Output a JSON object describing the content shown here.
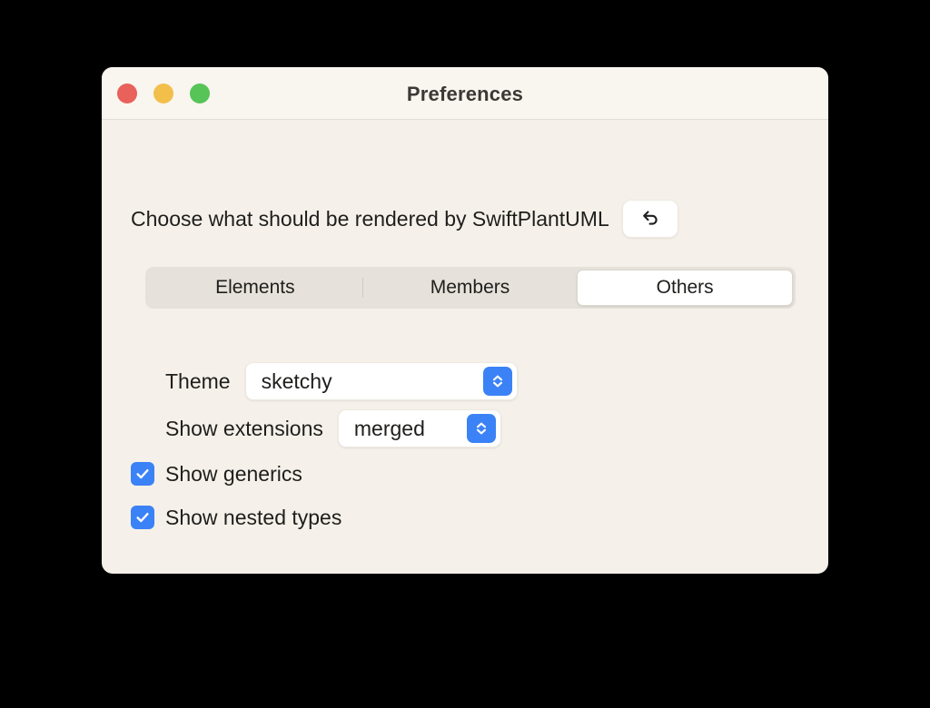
{
  "window": {
    "title": "Preferences",
    "traffic_lights": [
      {
        "name": "close",
        "color": "#E8615A"
      },
      {
        "name": "minimize",
        "color": "#F2BF4B"
      },
      {
        "name": "zoom",
        "color": "#57C457"
      }
    ],
    "background_color": "#F5F1EA",
    "titlebar_color": "#F9F5EF"
  },
  "description": {
    "text": "Choose what should be rendered by SwiftPlantUML",
    "reset_icon": "undo-arrow-icon"
  },
  "tabs": [
    {
      "label": "Elements",
      "selected": false
    },
    {
      "label": "Members",
      "selected": false
    },
    {
      "label": "Others",
      "selected": true
    }
  ],
  "fields": [
    {
      "label": "Theme",
      "value": "sketchy",
      "control": "popup-button",
      "stepper_icon": "chevron-up-down-icon"
    },
    {
      "label": "Show extensions",
      "value": "merged",
      "control": "popup-button",
      "stepper_icon": "chevron-up-down-icon"
    }
  ],
  "checkboxes": [
    {
      "label": "Show generics",
      "checked": true,
      "icon": "checkmark-icon"
    },
    {
      "label": "Show nested types",
      "checked": true,
      "icon": "checkmark-icon"
    }
  ],
  "colors": {
    "accent_blue": "#3B82F6",
    "text": "#1F1E1C",
    "tabbar_track": "#E6E2DB"
  }
}
